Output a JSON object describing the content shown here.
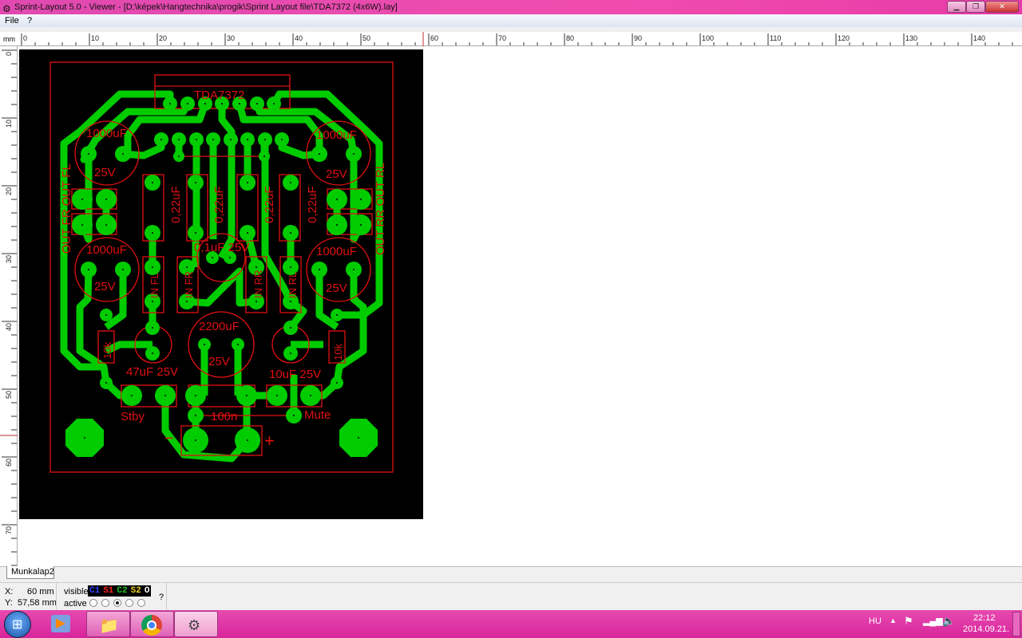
{
  "window": {
    "title": "Sprint-Layout 5.0 - Viewer - [D:\\képek\\Hangtechnika\\progik\\Sprint Layout file\\TDA7372 (4x6W).lay]",
    "buttons": [
      "minimize",
      "maximize",
      "close"
    ]
  },
  "menu": {
    "items": [
      "File",
      "?"
    ]
  },
  "ruler": {
    "unit": "mm",
    "h_ticks": [
      "0",
      "10",
      "20",
      "30",
      "40",
      "50",
      "60",
      "70",
      "80",
      "90",
      "100",
      "110",
      "120",
      "130",
      "140"
    ],
    "v_ticks": [
      "0",
      "10",
      "20",
      "30",
      "40",
      "50",
      "60",
      "70"
    ]
  },
  "pcb": {
    "colors": {
      "board": "#000000",
      "copper": "#00cc00",
      "silk": "#e01010"
    },
    "labels": {
      "ic": "TDA7372",
      "c1": "1000uF",
      "c1v": "25V",
      "c2": "1000uF",
      "c2v": "25V",
      "c3": "1000uF",
      "c3v": "25V",
      "c4": "1000uF",
      "c4v": "25V",
      "film": "0,22uF",
      "c01": "0,1uF 25V",
      "out_left": "OUT FR OUT FL",
      "out_right": "OUT RR OUT RL",
      "in_fl": "IN FL",
      "in_fr": "IN FR",
      "in_rr": "IN RR",
      "in_rl": "IN RL",
      "c47": "47uF 25V",
      "c2200": "2200uF",
      "c2200v": "25V",
      "c10": "10uF 25V",
      "r10k": "10k",
      "stby": "Stby",
      "mute": "Mute",
      "c100n": "100n",
      "minus": "−",
      "plus": "+"
    }
  },
  "tab": {
    "label": "Munkalap2"
  },
  "status": {
    "x_label": "X:",
    "x_value": "60 mm",
    "y_label": "Y:",
    "y_value": "57,58 mm",
    "visible_label": "visible",
    "active_label": "active",
    "layers": [
      {
        "name": "C1",
        "color": "#3040ff"
      },
      {
        "name": "S1",
        "color": "#ff2020"
      },
      {
        "name": "C2",
        "color": "#20c020"
      },
      {
        "name": "S2",
        "color": "#e8d020"
      },
      {
        "name": "O",
        "color": "#ffffff"
      }
    ],
    "active_layer": "C2",
    "help": "?"
  },
  "taskbar": {
    "apps": [
      "start",
      "media-player",
      "explorer",
      "chrome",
      "sprint-layout"
    ],
    "lang": "HU",
    "time": "22:12",
    "date": "2014.09.21."
  }
}
